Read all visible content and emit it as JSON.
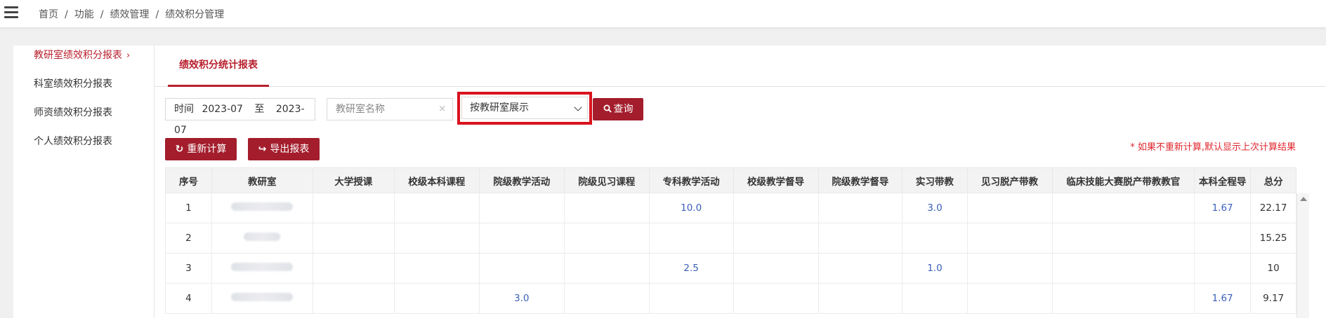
{
  "breadcrumb": [
    "首页",
    "功能",
    "绩效管理",
    "绩效积分管理"
  ],
  "breadcrumb_sep": "/",
  "sidebar": {
    "items": [
      {
        "label": "教研室绩效积分报表",
        "active": true,
        "chevron": "›"
      },
      {
        "label": "科室绩效积分报表"
      },
      {
        "label": "师资绩效积分报表"
      },
      {
        "label": "个人绩效积分报表"
      }
    ]
  },
  "tab": {
    "label": "绩效积分统计报表"
  },
  "filters": {
    "time_label": "时间",
    "start": "2023-07",
    "to": "至",
    "end": "2023-07",
    "name_placeholder": "教研室名称",
    "clear_icon": "×",
    "select_value": "按教研室展示"
  },
  "buttons": {
    "query": "查询",
    "recalc": "重新计算",
    "export": "导出报表"
  },
  "notice": "* 如果不重新计算,默认显示上次计算结果",
  "table": {
    "headers": [
      "序号",
      "教研室",
      "大学授课",
      "校级本科课程",
      "院级教学活动",
      "院级见习课程",
      "专科教学活动",
      "校级教学督导",
      "院级教学督导",
      "实习带教",
      "见习脱产带教",
      "临床技能大赛脱产带教教官",
      "本科全程导",
      "总分"
    ],
    "rows": [
      [
        "1",
        "",
        "",
        "",
        "",
        "",
        "10.0",
        "",
        "",
        "3.0",
        "",
        "",
        "1.67",
        "22.17"
      ],
      [
        "2",
        "",
        "",
        "",
        "",
        "",
        "",
        "",
        "",
        "",
        "",
        "",
        "",
        "15.25"
      ],
      [
        "3",
        "",
        "",
        "",
        "",
        "",
        "2.5",
        "",
        "",
        "1.0",
        "",
        "",
        "",
        "10"
      ],
      [
        "4",
        "",
        "",
        "",
        "3.0",
        "",
        "",
        "",
        "",
        "",
        "",
        "",
        "1.67",
        "9.17"
      ]
    ]
  },
  "colors": {
    "accent": "#a31d2c",
    "active_text": "#b8202e",
    "highlight": "#d9141e",
    "link": "#3a5fb8",
    "notice": "#e0262d"
  },
  "icons": {
    "menu": "hamburger-icon",
    "query": "search-icon",
    "recalc": "refresh-icon",
    "export": "share-icon",
    "select": "chevron-down-icon"
  }
}
